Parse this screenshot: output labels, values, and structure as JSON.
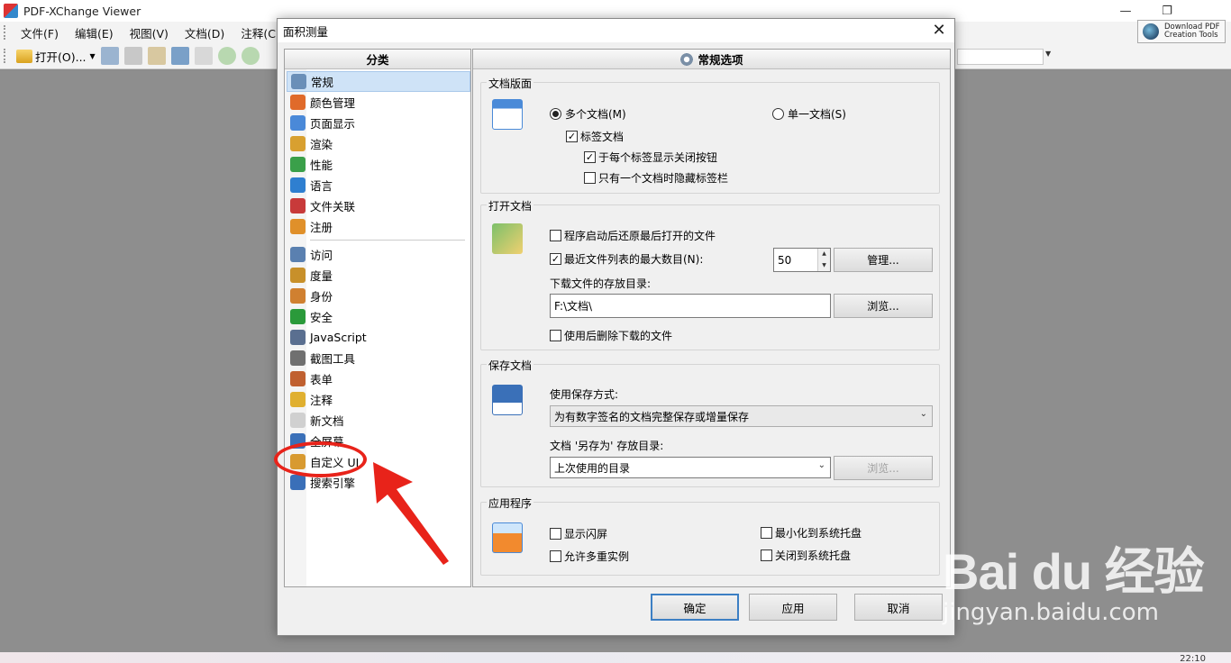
{
  "app": {
    "title": "PDF-XChange Viewer",
    "menu": [
      "文件(F)",
      "编辑(E)",
      "视图(V)",
      "文档(D)",
      "注释(C)"
    ],
    "toolbar_open": "打开(O)...",
    "download_label_1": "Download PDF",
    "download_label_2": "Creation Tools",
    "clock": "22:10"
  },
  "dialog": {
    "title": "面积测量",
    "categories_header": "分类",
    "options_header": "常规选项",
    "categories_group1": [
      {
        "label": "常规",
        "selected": true,
        "icon": "settings-icon",
        "color": "#6a8fb8"
      },
      {
        "label": "颜色管理",
        "icon": "color-palette-icon",
        "color": "#e06a2a"
      },
      {
        "label": "页面显示",
        "icon": "page-display-icon",
        "color": "#4a89d8"
      },
      {
        "label": "渲染",
        "icon": "brush-icon",
        "color": "#d8a030"
      },
      {
        "label": "性能",
        "icon": "performance-chart-icon",
        "color": "#3aa04a"
      },
      {
        "label": "语言",
        "icon": "globe-icon",
        "color": "#2f7fd0"
      },
      {
        "label": "文件关联",
        "icon": "file-association-icon",
        "color": "#c83a3a"
      },
      {
        "label": "注册",
        "icon": "register-user-icon",
        "color": "#e0902a"
      }
    ],
    "categories_group2": [
      {
        "label": "访问",
        "icon": "access-link-icon",
        "color": "#5a80b0"
      },
      {
        "label": "度量",
        "icon": "ruler-icon",
        "color": "#c8902a"
      },
      {
        "label": "身份",
        "icon": "identity-user-icon",
        "color": "#d08030"
      },
      {
        "label": "安全",
        "icon": "shield-icon",
        "color": "#2a9a3a"
      },
      {
        "label": "JavaScript",
        "icon": "javascript-icon",
        "color": "#5a6f90"
      },
      {
        "label": "截图工具",
        "icon": "camera-icon",
        "color": "#707070"
      },
      {
        "label": "表单",
        "icon": "form-icon",
        "color": "#c06030"
      },
      {
        "label": "注释",
        "icon": "comment-icon",
        "color": "#e0b030"
      },
      {
        "label": "新文档",
        "icon": "new-document-icon",
        "color": "#d0d0d0"
      },
      {
        "label": "全屏幕",
        "icon": "fullscreen-icon",
        "color": "#3a70b8"
      },
      {
        "label": "自定义 UI",
        "icon": "customize-ui-icon",
        "color": "#d89a30"
      },
      {
        "label": "搜索引擎",
        "icon": "search-engine-icon",
        "color": "#3a6fb8"
      }
    ],
    "doc_tabs": {
      "title": "文档版面",
      "multi_doc": "多个文档(M)",
      "single_doc": "单一文档(S)",
      "tabbed_docs": "标签文档",
      "close_btn_each_tab": "于每个标签显示关闭按钮",
      "hide_tabbar_single": "只有一个文档时隐藏标签栏"
    },
    "open_docs": {
      "title": "打开文档",
      "restore_last": "程序启动后还原最后打开的文件",
      "recent_max": "最近文件列表的最大数目(N):",
      "recent_value": "50",
      "manage_button": "管理...",
      "download_dir_label": "下载文件的存放目录:",
      "download_dir_value": "F:\\文档\\",
      "browse_button": "浏览...",
      "delete_after_use": "使用后删除下载的文件"
    },
    "save_docs": {
      "title": "保存文档",
      "save_mode_label": "使用保存方式:",
      "save_mode_value": "为有数字签名的文档完整保存或增量保存",
      "save_as_label": "文档 '另存为' 存放目录:",
      "save_as_value": "上次使用的目录",
      "browse_button": "浏览..."
    },
    "application": {
      "title": "应用程序",
      "splash": "显示闪屏",
      "multi_instance": "允许多重实例",
      "minimize_tray": "最小化到系统托盘",
      "close_tray": "关闭到系统托盘"
    },
    "buttons": {
      "ok": "确定",
      "apply": "应用",
      "cancel": "取消"
    }
  },
  "watermark": {
    "logo": "Bai du 经验",
    "url": "jingyan.baidu.com"
  },
  "colors": {
    "annotation_red": "#e8231a",
    "selection_blue": "#cfe3f7",
    "default_button_border": "#3c7fc4"
  }
}
